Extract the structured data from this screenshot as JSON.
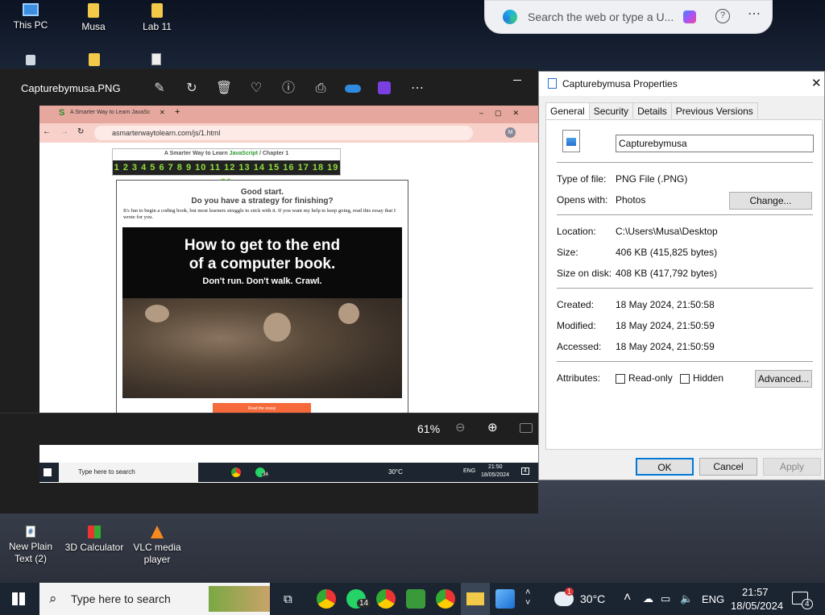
{
  "desktop": {
    "icons": [
      {
        "label": "This PC",
        "icon": "pc-icon"
      },
      {
        "label": "Musa",
        "icon": "folder-icon"
      },
      {
        "label": "Lab 11",
        "icon": "folder-icon"
      },
      {
        "label": "New Plain Text (2)",
        "icon": "text-file-icon"
      },
      {
        "label": "3D Calculator",
        "icon": "calculator-icon"
      },
      {
        "label": "VLC media player",
        "icon": "vlc-icon"
      }
    ]
  },
  "edge_search": {
    "placeholder": "Search the web or type a U..."
  },
  "viewer": {
    "title": "Capturebymusa.PNG",
    "zoom": "61%"
  },
  "inner": {
    "tab_title": "A Smarter Way to Learn JavaSc",
    "url": "asmarterwaytolearn.com/js/1.html",
    "chapter_prefix": "A Smarter Way to Learn ",
    "chapter_js": "JavaScript",
    "chapter_suffix": " / Chapter 1",
    "numbers": "1 2 3 4 5 6 7 8 9 10 11 12 13 14 15 16 17 18 19 20",
    "good_start": "Good start.",
    "strategy": "Do you have a strategy for finishing?",
    "intro": "It's fun to begin a coding book, but most learners struggle to stick with it. If you want my help to keep going, read this essay that I wrote for you.",
    "banner_line1": "How to get to the end",
    "banner_line2": "of a computer book.",
    "banner_line3": "Don't run. Don't walk. Crawl.",
    "read_button": "Read the essay",
    "taskbar_search": "Type here to search",
    "temp": "30°C",
    "lang": "ENG",
    "time": "21:50",
    "date": "18/05/2024",
    "whatsapp_badge": "34",
    "notif_badge": "4"
  },
  "properties": {
    "title": "Capturebymusa Properties",
    "tabs": [
      "General",
      "Security",
      "Details",
      "Previous Versions"
    ],
    "filename": "Capturebymusa",
    "type_label": "Type of file:",
    "type_value": "PNG File (.PNG)",
    "opens_label": "Opens with:",
    "opens_value": "Photos",
    "change_button": "Change...",
    "location_label": "Location:",
    "location_value": "C:\\Users\\Musa\\Desktop",
    "size_label": "Size:",
    "size_value": "406 KB (415,825 bytes)",
    "disk_label": "Size on disk:",
    "disk_value": "408 KB (417,792 bytes)",
    "created_label": "Created:",
    "created_value": "18 May 2024, 21:50:58",
    "modified_label": "Modified:",
    "modified_value": "18 May 2024, 21:50:59",
    "accessed_label": "Accessed:",
    "accessed_value": "18 May 2024, 21:50:59",
    "attributes_label": "Attributes:",
    "readonly_label": "Read-only",
    "hidden_label": "Hidden",
    "advanced_button": "Advanced...",
    "ok_button": "OK",
    "cancel_button": "Cancel",
    "apply_button": "Apply"
  },
  "taskbar": {
    "search_placeholder": "Type here to search",
    "weather_temp": "30°C",
    "weather_badge": "1",
    "whatsapp_badge": "14",
    "lang": "ENG",
    "time": "21:57",
    "date": "18/05/2024",
    "notif_badge": "4"
  }
}
